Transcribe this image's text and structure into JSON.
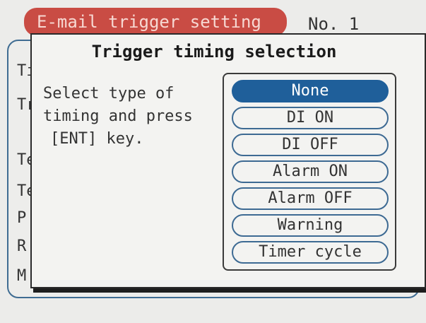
{
  "background": {
    "title_tab": "E-mail trigger setting",
    "number": "No. 1",
    "row_stubs": [
      "Ti",
      "Tr",
      "Te",
      "Te",
      "P",
      "R",
      "M"
    ]
  },
  "dialog": {
    "title": "Trigger timing selection",
    "instructions": [
      "Select type of",
      "timing and press",
      "[ENT] key."
    ],
    "options": [
      {
        "label": "None",
        "selected": true
      },
      {
        "label": "DI ON",
        "selected": false
      },
      {
        "label": "DI OFF",
        "selected": false
      },
      {
        "label": "Alarm ON",
        "selected": false
      },
      {
        "label": "Alarm OFF",
        "selected": false
      },
      {
        "label": "Warning",
        "selected": false
      },
      {
        "label": "Timer cycle",
        "selected": false
      }
    ]
  },
  "colors": {
    "title_tab": "#c94c44",
    "selected_option": "#1f5f9a",
    "option_border": "#3d6a93"
  }
}
